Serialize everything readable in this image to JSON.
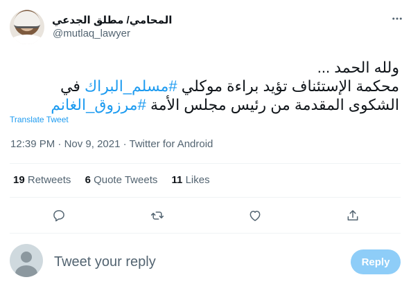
{
  "user": {
    "display_name": "المحامي/ مطلق الجدعي",
    "handle": "@mutlaq_lawyer"
  },
  "tweet": {
    "line1": "ولله الحمد ...",
    "line2_prefix": "محكمة الإستئناف تؤيد براءة موكلي ",
    "hashtag1": "#مسلم_البراك",
    "line2_suffix": " في",
    "line3_prefix": "الشكوى المقدمة من رئيس مجلس الأمة ",
    "hashtag2": "#مرزوق_الغانم",
    "translate_label": "Translate Tweet"
  },
  "meta": {
    "time": "12:39 PM",
    "separator1": " · ",
    "date": "Nov 9, 2021",
    "separator2": " · ",
    "client": "Twitter for Android"
  },
  "stats": {
    "retweets_count": "19",
    "retweets_label": "Retweets",
    "quotes_count": "6",
    "quotes_label": "Quote Tweets",
    "likes_count": "11",
    "likes_label": "Likes"
  },
  "reply_box": {
    "placeholder": "Tweet your reply",
    "button_label": "Reply"
  },
  "icons": {
    "more": "more-dots-icon",
    "reply": "reply-icon",
    "retweet": "retweet-icon",
    "like": "heart-icon",
    "share": "share-icon"
  },
  "colors": {
    "accent": "#1d9bf0",
    "reply_button_disabled": "#8ecdf8",
    "secondary_text": "#536471"
  }
}
